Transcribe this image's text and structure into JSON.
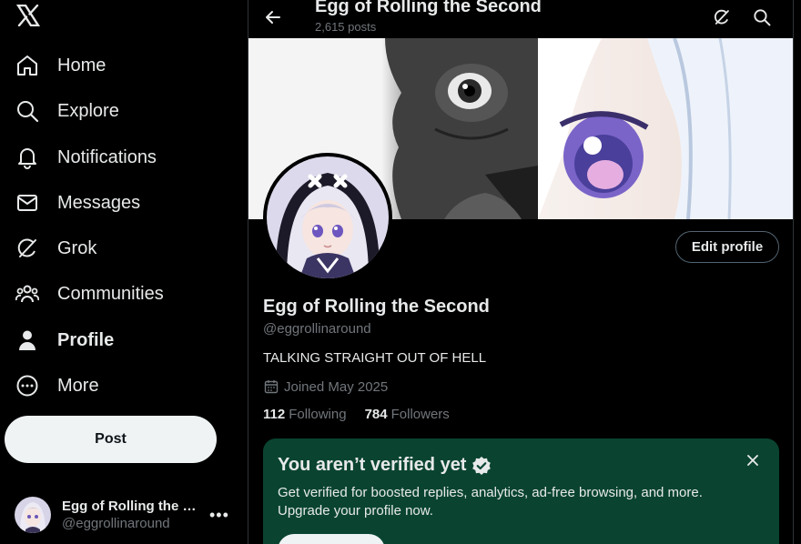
{
  "sidebar": {
    "logo": "x-logo-icon",
    "items": [
      {
        "label": "Home",
        "icon": "home-icon"
      },
      {
        "label": "Explore",
        "icon": "search-icon"
      },
      {
        "label": "Notifications",
        "icon": "bell-icon"
      },
      {
        "label": "Messages",
        "icon": "envelope-icon"
      },
      {
        "label": "Grok",
        "icon": "grok-icon"
      },
      {
        "label": "Communities",
        "icon": "people-icon"
      },
      {
        "label": "Profile",
        "icon": "person-icon",
        "active": true
      },
      {
        "label": "More",
        "icon": "more-circle-icon"
      }
    ],
    "post_label": "Post",
    "account": {
      "display_name": "Egg of Rolling the S...",
      "handle": "@eggrollinaround",
      "more": "•••"
    }
  },
  "header": {
    "title": "Egg of Rolling the Second",
    "subtitle": "2,615 posts"
  },
  "profile": {
    "edit_label": "Edit profile",
    "name": "Egg of Rolling the Second",
    "handle": "@eggrollinaround",
    "bio": "TALKING STRAIGHT OUT OF HELL",
    "joined": "Joined May 2025",
    "following_count": "112",
    "following_label": "Following",
    "followers_count": "784",
    "followers_label": "Followers"
  },
  "verify_card": {
    "title": "You aren’t verified yet",
    "description": "Get verified for boosted replies, analytics, ad-free browsing, and more. Upgrade your profile now."
  },
  "colors": {
    "background": "#000000",
    "text": "#e7e9ea",
    "secondary_text": "#71767b",
    "border": "#2f3336",
    "verify_card_bg": "#0a4430",
    "post_button_bg": "#eff3f4"
  }
}
